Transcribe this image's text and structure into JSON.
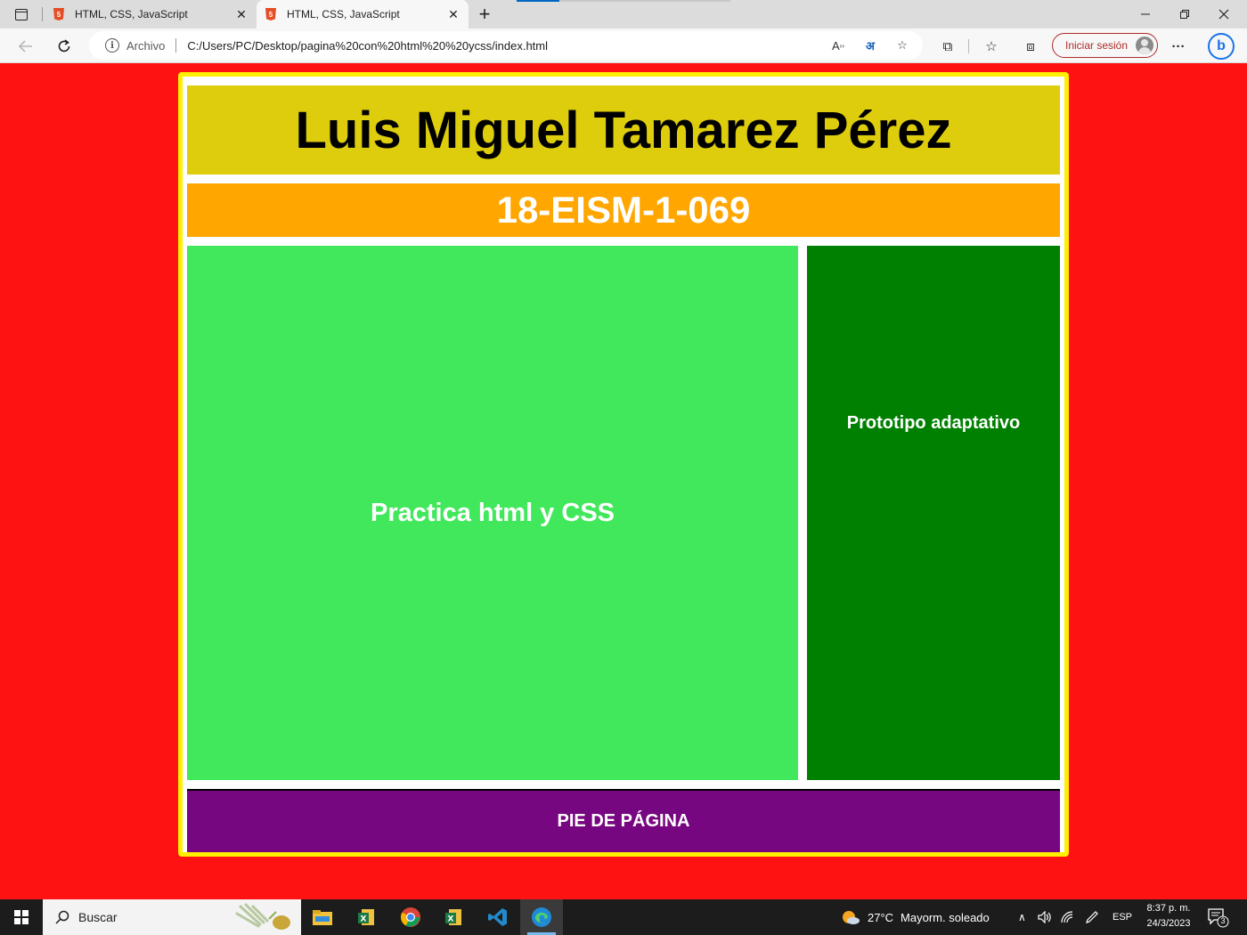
{
  "browser": {
    "tabs": [
      {
        "title": "HTML, CSS, JavaScript",
        "active": false
      },
      {
        "title": "HTML, CSS, JavaScript",
        "active": true
      }
    ],
    "address_scheme": "Archivo",
    "address_url": "C:/Users/PC/Desktop/pagina%20con%20html%20%20ycss/index.html",
    "signin_label": "Iniciar sesión"
  },
  "page": {
    "header_title": "Luis Miguel Tamarez Pérez",
    "id_code": "18-EISM-1-069",
    "main_text": "Practica html y CSS",
    "aside_text": "Prototipo adaptativo",
    "footer_text": "PIE DE PÁGINA",
    "colors": {
      "background": "#fe1212",
      "border": "#ffef00",
      "header": "#ddcd0c",
      "subheader": "#ffa600",
      "main": "#42e85c",
      "aside": "#008000",
      "footer": "#770780"
    }
  },
  "taskbar": {
    "search_placeholder": "Buscar",
    "weather_temp": "27°C",
    "weather_desc": "Mayorm. soleado",
    "language": "ESP",
    "time": "8:37 p. m.",
    "date": "24/3/2023",
    "notification_count": "3",
    "apps": [
      "file-explorer",
      "excel",
      "chrome",
      "excel-2",
      "vscode",
      "edge"
    ]
  }
}
